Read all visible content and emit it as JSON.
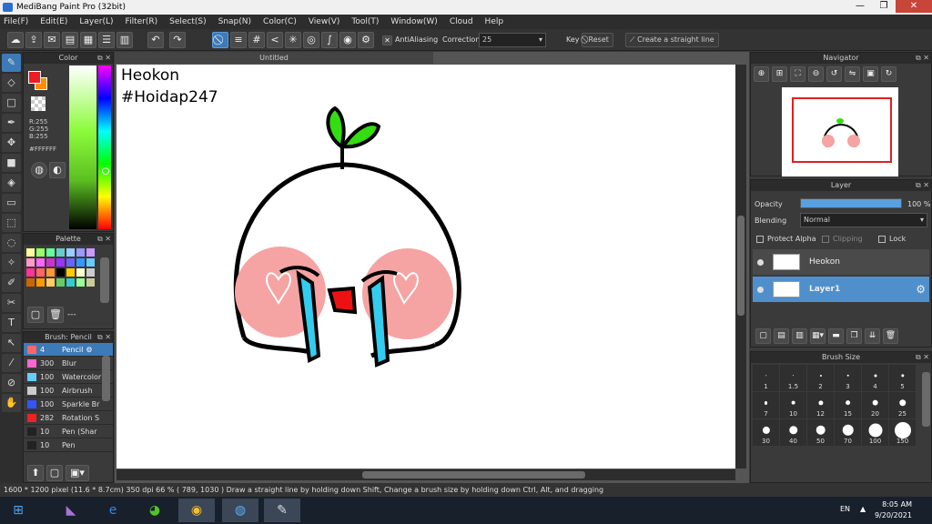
{
  "window": {
    "title": "MediBang Paint Pro (32bit)"
  },
  "menu": [
    "File(F)",
    "Edit(E)",
    "Layer(L)",
    "Filter(R)",
    "Select(S)",
    "Snap(N)",
    "Color(C)",
    "View(V)",
    "Tool(T)",
    "Window(W)",
    "Cloud",
    "Help"
  ],
  "toolbar": {
    "antialiasing_label": "AntiAliasing",
    "correction_label": "Correction",
    "correction_value": "25",
    "key_label": "Key",
    "reset_label": "Reset",
    "straight_line_label": "Create a straight line"
  },
  "document": {
    "tab": "Untitled"
  },
  "color_panel": {
    "title": "Color",
    "r": "R:255",
    "g": "G:255",
    "b": "B:255",
    "hex": "#FFFFFF",
    "fg": "#ee1c24",
    "bg": "#ff8c00"
  },
  "palette_panel": {
    "title": "Palette",
    "footer": "---",
    "colors": [
      "#ffff99",
      "#99ff66",
      "#66ff99",
      "#66cccc",
      "#99ccff",
      "#9999ff",
      "#cc99ff",
      "#ff99cc",
      "#ff66ff",
      "#cc33cc",
      "#9933ff",
      "#6666ff",
      "#3399ff",
      "#66ccff",
      "#ff3399",
      "#ff6666",
      "#ff9933",
      "#000000",
      "#ffcc00",
      "#ffffcc",
      "#cccccc",
      "#cc6600",
      "#ff9900",
      "#ffcc66",
      "#66cc66",
      "#33cccc",
      "#99ff99",
      "#cccc99"
    ]
  },
  "brush_panel": {
    "title": "Brush: Pencil",
    "items": [
      {
        "size": "4",
        "name": "Pencil",
        "color": "#ff6666"
      },
      {
        "size": "300",
        "name": "Blur",
        "color": "#ff66cc"
      },
      {
        "size": "100",
        "name": "Watercolor",
        "color": "#66ccff"
      },
      {
        "size": "100",
        "name": "Airbrush",
        "color": "#cccccc"
      },
      {
        "size": "100",
        "name": "Sparkle Br",
        "color": "#3355ff"
      },
      {
        "size": "282",
        "name": "Rotation S",
        "color": "#ee2222"
      },
      {
        "size": "10",
        "name": "Pen (Shar",
        "color": "#222222"
      },
      {
        "size": "10",
        "name": "Pen",
        "color": "#222222"
      }
    ]
  },
  "canvas": {
    "text_line1": "Heokon",
    "text_line2": "#Hoidap247"
  },
  "navigator": {
    "title": "Navigator"
  },
  "layer_panel": {
    "title": "Layer",
    "opacity_label": "Opacity",
    "opacity_value": "100 %",
    "opacity_fraction": 1.0,
    "blending_label": "Blending",
    "blending_value": "Normal",
    "protect_alpha": "Protect Alpha",
    "clipping": "Clipping",
    "lock": "Lock",
    "layers": [
      {
        "name": "Heokon",
        "selected": false
      },
      {
        "name": "Layer1",
        "selected": true
      }
    ]
  },
  "brush_size_panel": {
    "title": "Brush Size",
    "sizes": [
      "1",
      "1.5",
      "2",
      "3",
      "4",
      "5",
      "7",
      "10",
      "12",
      "15",
      "20",
      "25",
      "30",
      "40",
      "50",
      "70",
      "100",
      "150"
    ]
  },
  "status": {
    "text": "1600 * 1200 pixel   (11.6 * 8.7cm)   350 dpi   66 %   ( 789, 1030 )   Draw a straight line by holding down Shift, Change a brush size by holding down Ctrl, Alt, and dragging"
  },
  "taskbar": {
    "lang": "EN",
    "time": "8:05 AM",
    "date": "9/20/2021"
  }
}
